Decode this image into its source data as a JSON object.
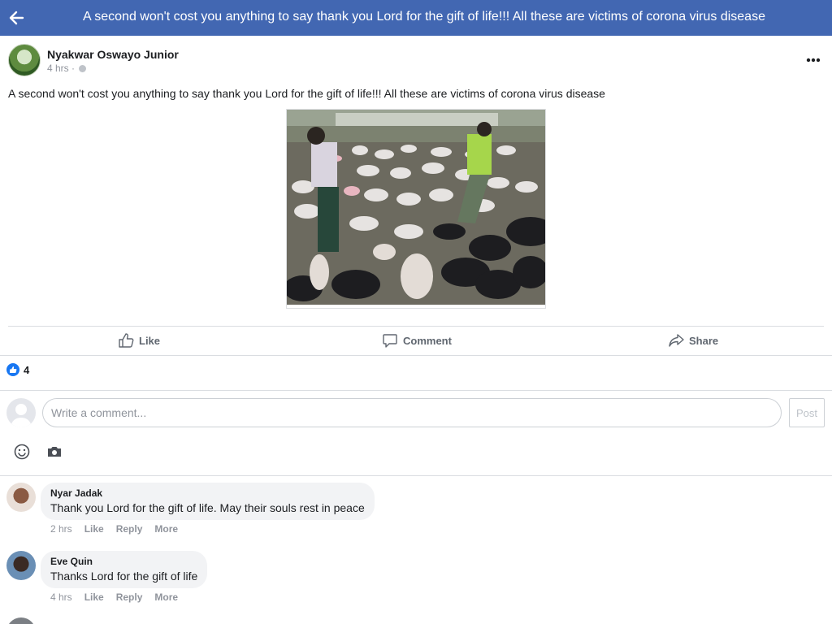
{
  "topbar": {
    "title": "A second won't cost you anything to say thank you Lord for the gift of life!!! All these are victims of corona virus disease",
    "back_icon": "arrow-left-icon",
    "color": "#4267b2"
  },
  "post": {
    "author": "Nyakwar Oswayo Junior",
    "time": "4 hrs",
    "separator": "·",
    "privacy_icon": "globe-icon",
    "more_icon": "more-horizontal-icon",
    "text": "A second won't cost you anything to say thank you Lord for the gift of life!!! All these are victims of corona virus disease"
  },
  "actions": {
    "like": "Like",
    "comment": "Comment",
    "share": "Share"
  },
  "reactions": {
    "count": "4",
    "icon": "thumbs-up-icon",
    "color": "#1877f2"
  },
  "composer": {
    "placeholder": "Write a comment...",
    "post_label": "Post",
    "emoji_icon": "smiley-icon",
    "camera_icon": "camera-icon"
  },
  "comments": [
    {
      "name": "Nyar Jadak",
      "text": "Thank you Lord for the gift of life. May their souls rest in peace",
      "time": "2 hrs",
      "like": "Like",
      "reply": "Reply",
      "more": "More"
    },
    {
      "name": "Eve Quin",
      "text": "Thanks Lord for the gift of life",
      "time": "4 hrs",
      "like": "Like",
      "reply": "Reply",
      "more": "More"
    }
  ]
}
